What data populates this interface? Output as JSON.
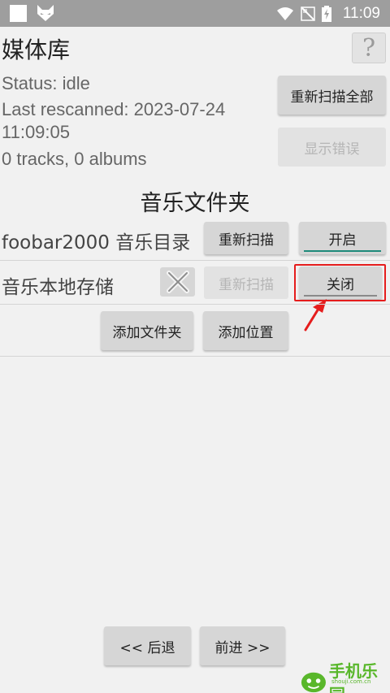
{
  "statusbar": {
    "time": "11:09",
    "icons": [
      "square-icon",
      "fox-icon",
      "wifi-icon",
      "no-sim-icon",
      "battery-charging-icon"
    ]
  },
  "header": {
    "title": "媒体库",
    "help_label": "?"
  },
  "status": {
    "line1": "Status: idle",
    "line2": "Last rescanned: 2023-07-24",
    "line3": "11:09:05",
    "line4": "0 tracks, 0 albums",
    "rescan_all_label": "重新扫描全部",
    "show_errors_label": "显示错误"
  },
  "folders": {
    "section_title": "音乐文件夹",
    "rows": [
      {
        "label": "foobar2000 音乐目录",
        "rescan_label": "重新扫描",
        "toggle_label": "开启",
        "toggle_state": "on"
      },
      {
        "label": "音乐本地存储",
        "rescan_label": "重新扫描",
        "toggle_label": "关闭",
        "toggle_state": "off"
      }
    ],
    "add_folder_label": "添加文件夹",
    "add_location_label": "添加位置"
  },
  "footer": {
    "back_label": "<< 后退",
    "forward_label": "前进 >>"
  },
  "watermark": {
    "text": "手机乐园",
    "sub": "shouji.com.cn"
  },
  "colors": {
    "statusbar": "#9e9e9e",
    "background": "#f1f1f1",
    "button": "#d6d6d6",
    "toggle_on_underline": "#1e8a7a",
    "highlight": "#e51d1d",
    "watermark": "#59b72b"
  }
}
